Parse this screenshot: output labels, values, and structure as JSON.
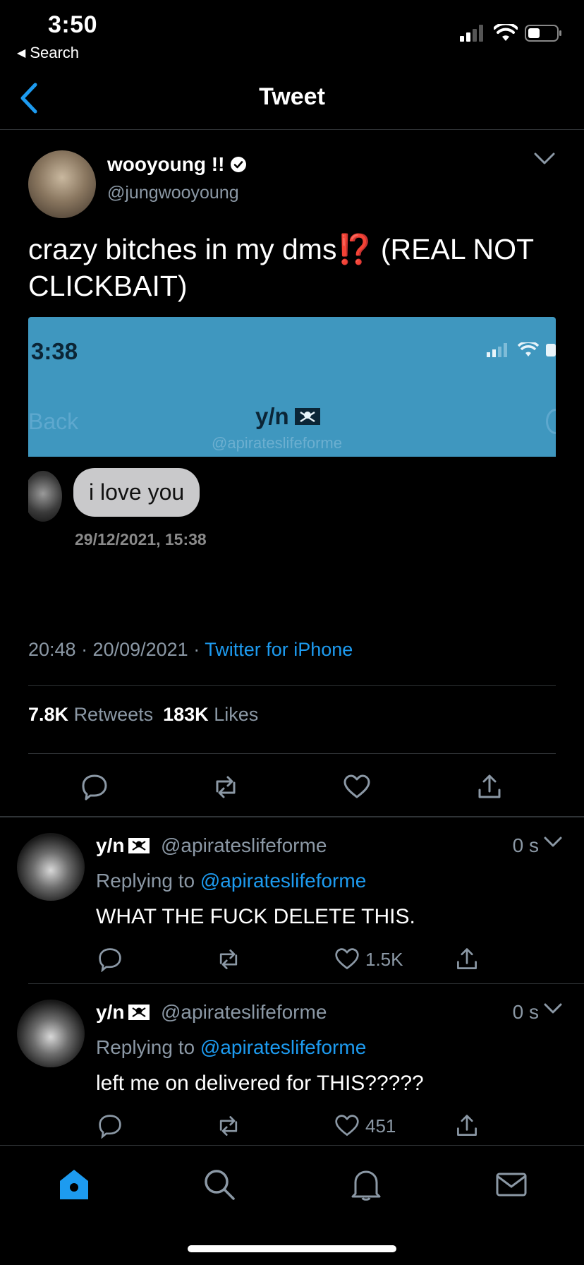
{
  "status_bar": {
    "time": "3:50",
    "back_app": "Search"
  },
  "nav": {
    "title": "Tweet"
  },
  "tweet": {
    "author_name": "wooyoung !!",
    "author_handle": "@jungwooyoung",
    "text_before": "crazy bitches in my dms",
    "text_mark": "⁉️",
    "text_after": " (REAL NOT CLICKBAIT)",
    "timestamp": "20:48 · 20/09/2021 · ",
    "source": "Twitter for iPhone",
    "retweet_count": "7.8K",
    "retweet_label": "Retweets",
    "like_count": "183K",
    "like_label": "Likes"
  },
  "embedded_image": {
    "time": "3:38",
    "back": "Back",
    "name": "y/n",
    "handle": "@apirateslifeforme",
    "message": "i love you",
    "date": "29/12/2021, 15:38"
  },
  "replies": [
    {
      "name": "y/n",
      "handle": "@apirateslifeforme",
      "time": "0 s",
      "replying_prefix": "Replying to ",
      "replying_to": "@apirateslifeforme",
      "text": "WHAT THE FUCK DELETE THIS.",
      "likes": "1.5K"
    },
    {
      "name": "y/n",
      "handle": "@apirateslifeforme",
      "time": "0 s",
      "replying_prefix": "Replying to ",
      "replying_to": "@apirateslifeforme",
      "text": "left me on delivered for THIS?????",
      "likes": "451"
    }
  ],
  "colors": {
    "accent": "#1d9bf0",
    "muted": "#8b98a5",
    "background": "#000000",
    "divider": "#2f3336"
  },
  "icons": [
    "signal-icon",
    "wifi-icon",
    "battery-icon",
    "back-chevron-icon",
    "verified-icon",
    "chevron-down-icon",
    "reply-icon",
    "retweet-icon",
    "like-icon",
    "share-icon",
    "pirate-flag-icon",
    "home-icon",
    "search-icon",
    "notifications-icon",
    "messages-icon"
  ]
}
